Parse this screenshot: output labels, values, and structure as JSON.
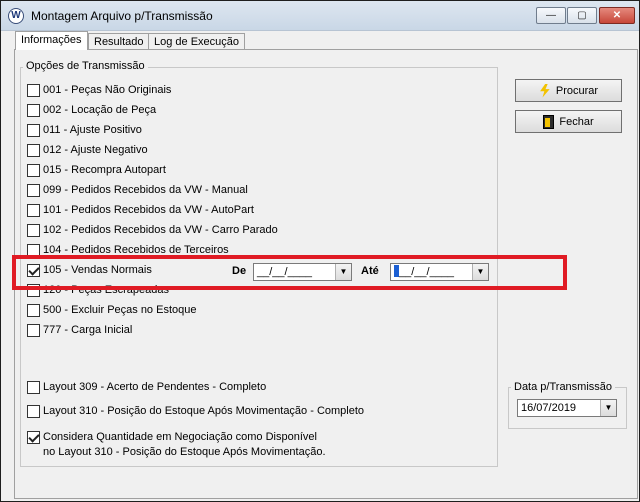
{
  "window": {
    "title": "Montagem Arquivo p/Transmissão",
    "app_icon": "volkswagen-logo-icon",
    "controls": {
      "minimize": "—",
      "maximize": "▢",
      "close": "✕"
    }
  },
  "tabs": [
    {
      "label": "Informações",
      "active": true
    },
    {
      "label": "Resultado",
      "active": false
    },
    {
      "label": "Log de Execução",
      "active": false
    }
  ],
  "options_group": {
    "title": "Opções de Transmissão",
    "items": [
      {
        "label": "001 - Peças Não Originais",
        "checked": false
      },
      {
        "label": "002 - Locação de Peça",
        "checked": false
      },
      {
        "label": "011 - Ajuste Positivo",
        "checked": false
      },
      {
        "label": "012 - Ajuste Negativo",
        "checked": false
      },
      {
        "label": "015 - Recompra Autopart",
        "checked": false
      },
      {
        "label": "099 - Pedidos Recebidos da VW - Manual",
        "checked": false
      },
      {
        "label": "101 - Pedidos Recebidos da VW - AutoPart",
        "checked": false
      },
      {
        "label": "102 - Pedidos Recebidos da VW - Carro Parado",
        "checked": false
      },
      {
        "label": "104 - Pedidos Recebidos de Terceiros",
        "checked": false
      },
      {
        "label": "105 - Vendas Normais",
        "checked": true
      },
      {
        "label": "120 - Peças Escrapeadas",
        "checked": false
      },
      {
        "label": "500 - Excluir Peças no Estoque",
        "checked": false
      },
      {
        "label": "777 - Carga Inicial",
        "checked": false
      }
    ],
    "date_from_label": "De",
    "date_from_value": "__/__/____",
    "date_to_label": "Até",
    "date_to_value": "__/__/____",
    "layout_options": [
      {
        "label": "Layout 309 - Acerto de Pendentes - Completo",
        "checked": false
      },
      {
        "label": "Layout 310 - Posição do Estoque Após Movimentação - Completo",
        "checked": false
      }
    ],
    "considera": {
      "checked": true,
      "line1": "Considera Quantidade em Negociação como Disponível",
      "line2": "no Layout 310 - Posição do Estoque Após Movimentação."
    }
  },
  "buttons": {
    "procurar": "Procurar",
    "procurar_icon": "lightning-bolt-icon",
    "fechar": "Fechar",
    "fechar_icon": "exit-door-icon"
  },
  "data_transmissao": {
    "label": "Data p/Transmissão",
    "value": "16/07/2019"
  },
  "colors": {
    "highlight": "#e01b24",
    "close_button": "#c7473a",
    "accent_bolt": "#f2c200"
  }
}
